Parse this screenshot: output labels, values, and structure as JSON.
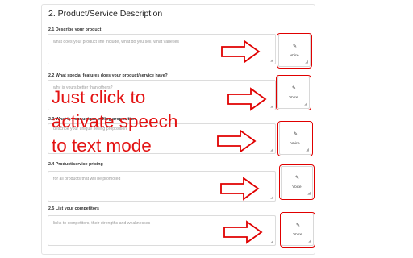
{
  "section": {
    "title": "2. Product/Service Description"
  },
  "questions": [
    {
      "label": "2.1 Describe your product",
      "placeholder": "what does your product line include, what do you sell, what varieties",
      "voice_label": "Voice"
    },
    {
      "label": "2.2 What special features does your product/service have?",
      "placeholder": "why is yours better than others?",
      "voice_label": "Voice"
    },
    {
      "label": "2.3 What is your unique selling proposition",
      "placeholder": "describe your unique selling proposition",
      "voice_label": "Voice"
    },
    {
      "label": "2.4 Product/service pricing",
      "placeholder": "for all products that will be promoted",
      "voice_label": "Voice"
    },
    {
      "label": "2.5 List your competitors",
      "placeholder": "links to competitors, their strengths and weaknesses",
      "voice_label": "Voice"
    }
  ],
  "annotation": {
    "lines": [
      "Just click to",
      "activate speech",
      "to text mode"
    ],
    "color": "#e31313"
  },
  "icons": {
    "voice_button": "pencil-mic-icon",
    "pointer": "right-arrow-icon"
  }
}
